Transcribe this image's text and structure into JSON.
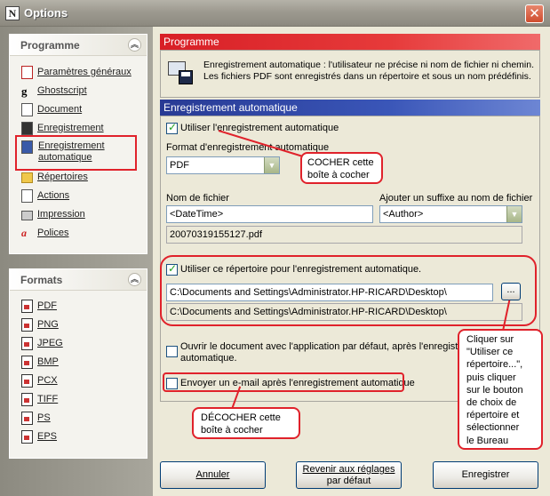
{
  "window": {
    "title": "Options",
    "app_icon_glyph": "N"
  },
  "sidebar": {
    "programme": {
      "title": "Programme",
      "items": [
        {
          "label": "Paramètres généraux",
          "icon": "settings-doc-icon"
        },
        {
          "label": "Ghostscript",
          "icon": "ghostscript-icon"
        },
        {
          "label": "Document",
          "icon": "document-icon"
        },
        {
          "label": "Enregistrement",
          "icon": "save-icon"
        },
        {
          "label": "Enregistrement automatique",
          "label_line1": "Enregistrement",
          "label_line2": "automatique",
          "icon": "autosave-icon"
        },
        {
          "label": "Répertoires",
          "icon": "folder-icon"
        },
        {
          "label": "Actions",
          "icon": "actions-icon"
        },
        {
          "label": "Impression",
          "icon": "printer-icon"
        },
        {
          "label": "Polices",
          "icon": "fonts-icon"
        }
      ]
    },
    "formats": {
      "title": "Formats",
      "items": [
        "PDF",
        "PNG",
        "JPEG",
        "BMP",
        "PCX",
        "TIFF",
        "PS",
        "EPS"
      ]
    }
  },
  "main": {
    "programme_header": "Programme",
    "description_line1": "Enregistrement automatique : l'utilisateur ne précise ni nom de fichier ni chemin.",
    "description_line2": "Les fichiers PDF sont enregistrés dans un répertoire et sous un nom prédéfinis.",
    "autosave_header": "Enregistrement automatique",
    "use_autosave_label": "Utiliser l'enregistrement automatique",
    "use_autosave_checked": true,
    "format_label": "Format d'enregistrement automatique",
    "format_value": "PDF",
    "filename_label": "Nom de fichier",
    "filename_value": "<DateTime>",
    "suffix_label": "Ajouter un suffixe au nom de fichier",
    "suffix_value": "<Author>",
    "filename_preview": "20070319155127.pdf",
    "use_dir_label": "Utiliser ce répertoire pour l'enregistrement automatique.",
    "use_dir_checked": true,
    "dir_value": "C:\\Documents and Settings\\Administrator.HP-RICARD\\Desktop\\",
    "dir_browse_label": "...",
    "dir_preview": "C:\\Documents and Settings\\Administrator.HP-RICARD\\Desktop\\",
    "open_doc_label_line1": "Ouvrir le document avec l'application par défaut, après l'enregistrement",
    "open_doc_label_line2": "automatique.",
    "open_doc_checked": false,
    "email_label": "Envoyer un e-mail après l'enregistrement automatique",
    "email_checked": false
  },
  "buttons": {
    "cancel": "Annuler",
    "defaults_line1": "Revenir aux réglages",
    "defaults_line2": "par défaut",
    "save": "Enregistrer"
  },
  "annotations": {
    "check_note": [
      "COCHER cette",
      "boîte à cocher"
    ],
    "uncheck_note": [
      "DÉCOCHER cette",
      "boîte à cocher"
    ],
    "dir_note": [
      "Cliquer sur",
      "\"Utiliser ce",
      "répertoire...\",",
      "puis cliquer",
      "sur le bouton",
      "de choix de",
      "répertoire et",
      "sélectionner",
      "le Bureau"
    ]
  },
  "colors": {
    "programme_header": "#e0222b",
    "autosave_header": "#2a3c9a",
    "annotation_red": "#e0222b"
  }
}
